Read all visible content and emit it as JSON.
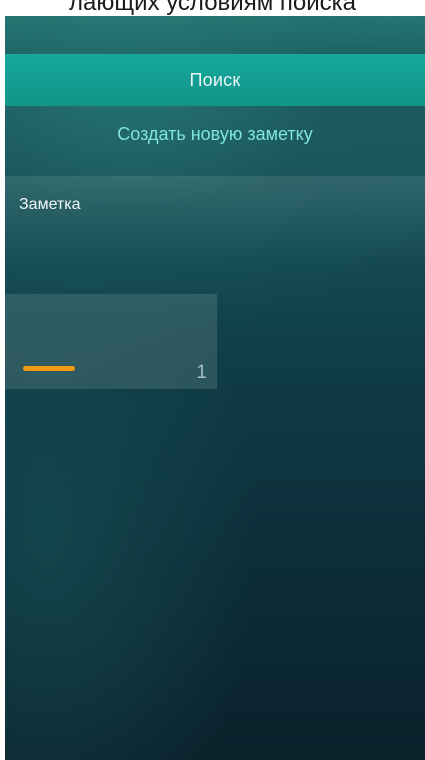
{
  "caption": {
    "text": "лающих условиям поиска"
  },
  "search": {
    "label": "Поиск"
  },
  "actions": {
    "create_note": "Создать новую заметку"
  },
  "notes": {
    "header": "Заметка",
    "items": [
      {
        "count": "1",
        "progress_color": "#f19a13"
      }
    ]
  },
  "colors": {
    "accent_teal": "#14a096",
    "create_link": "#7fe6da",
    "progress": "#f19a13"
  }
}
